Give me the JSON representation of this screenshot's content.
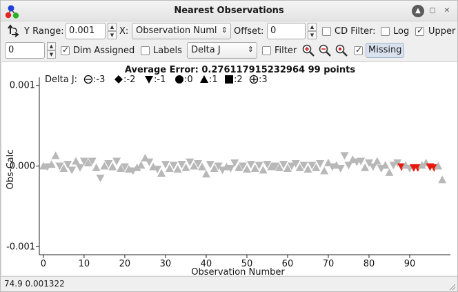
{
  "window": {
    "title": "Nearest Observations",
    "controls": [
      "help-icon",
      "maximize-icon",
      "close-icon"
    ]
  },
  "toolbar": {
    "y_range_label": "Y Range:",
    "y_range_value": "0.001",
    "x_label": "X:",
    "x_select_value": "Observation Numl",
    "offset_label": "Offset:",
    "offset_value": "0",
    "cd_filter_label": "CD Filter:",
    "log_label": "Log",
    "upper_label": "Upper",
    "cd_filter_checked": false,
    "log_checked": false,
    "upper_checked": true,
    "row2_value": "0",
    "dim_assigned_label": "Dim Assigned",
    "dim_assigned_checked": true,
    "labels_label": "Labels",
    "labels_checked": false,
    "color_by_value": "Delta J",
    "filter_label": "Filter",
    "filter_checked": false,
    "missing_label": "Missing",
    "missing_checked": true
  },
  "chart_data": {
    "type": "scatter",
    "title": "Average Error: 0.276117915232964  99 points",
    "xlabel": "Observation Number",
    "ylabel": "Obs-Calc",
    "xlim": [
      -1,
      100
    ],
    "ylim": [
      -0.0011,
      0.0011
    ],
    "xticks": [
      0,
      10,
      20,
      30,
      40,
      50,
      60,
      70,
      80,
      90
    ],
    "yticks": [
      0.001,
      0.0,
      -0.001
    ],
    "ytick_labels": [
      "0.001",
      "0.000",
      "-0.001"
    ],
    "legend_title": "Delta J:",
    "legend": [
      {
        "symbol": "circle-minus",
        "label": ":-3"
      },
      {
        "symbol": "diamond",
        "label": ":-2"
      },
      {
        "symbol": "triangle-down",
        "label": ":-1"
      },
      {
        "symbol": "circle",
        "label": ":0"
      },
      {
        "symbol": "triangle-up",
        "label": ":1"
      },
      {
        "symbol": "square",
        "label": ":2"
      },
      {
        "symbol": "circle-plus",
        "label": ":3"
      }
    ],
    "colors": {
      "default": "#b8b8b8",
      "highlight": "#e8190f"
    },
    "points": [
      {
        "x": 0,
        "y": 0.0,
        "m": "up",
        "c": "default"
      },
      {
        "x": 1,
        "y": -1e-05,
        "m": "down",
        "c": "default"
      },
      {
        "x": 2,
        "y": 2e-05,
        "m": "up",
        "c": "default"
      },
      {
        "x": 3,
        "y": 0.00013,
        "m": "up",
        "c": "default"
      },
      {
        "x": 4,
        "y": 0.0,
        "m": "down",
        "c": "default"
      },
      {
        "x": 5,
        "y": -3e-05,
        "m": "up",
        "c": "default"
      },
      {
        "x": 6,
        "y": 2e-05,
        "m": "down",
        "c": "default"
      },
      {
        "x": 7,
        "y": -5e-05,
        "m": "down",
        "c": "default"
      },
      {
        "x": 8,
        "y": 6e-05,
        "m": "up",
        "c": "default"
      },
      {
        "x": 9,
        "y": -2e-05,
        "m": "down",
        "c": "default"
      },
      {
        "x": 10,
        "y": 6e-05,
        "m": "down",
        "c": "default"
      },
      {
        "x": 11,
        "y": 4e-05,
        "m": "up",
        "c": "default"
      },
      {
        "x": 12,
        "y": 6e-05,
        "m": "down",
        "c": "default"
      },
      {
        "x": 13,
        "y": -2e-05,
        "m": "up",
        "c": "default"
      },
      {
        "x": 14,
        "y": -0.00015,
        "m": "down",
        "c": "default"
      },
      {
        "x": 15,
        "y": 0.0,
        "m": "up",
        "c": "default"
      },
      {
        "x": 16,
        "y": 3e-05,
        "m": "down",
        "c": "default"
      },
      {
        "x": 17,
        "y": -1e-05,
        "m": "up",
        "c": "default"
      },
      {
        "x": 18,
        "y": 6e-05,
        "m": "down",
        "c": "default"
      },
      {
        "x": 19,
        "y": -3e-05,
        "m": "up",
        "c": "default"
      },
      {
        "x": 20,
        "y": -1e-05,
        "m": "down",
        "c": "default"
      },
      {
        "x": 21,
        "y": -4e-05,
        "m": "up",
        "c": "default"
      },
      {
        "x": 22,
        "y": -6e-05,
        "m": "down",
        "c": "default"
      },
      {
        "x": 23,
        "y": -2e-05,
        "m": "up",
        "c": "default"
      },
      {
        "x": 24,
        "y": 1e-05,
        "m": "up",
        "c": "default"
      },
      {
        "x": 25,
        "y": 0.0001,
        "m": "up",
        "c": "default"
      },
      {
        "x": 26,
        "y": 5e-05,
        "m": "down",
        "c": "default"
      },
      {
        "x": 27,
        "y": -1e-05,
        "m": "up",
        "c": "default"
      },
      {
        "x": 28,
        "y": -4e-05,
        "m": "down",
        "c": "default"
      },
      {
        "x": 29,
        "y": -9e-05,
        "m": "up",
        "c": "default"
      },
      {
        "x": 30,
        "y": 2e-05,
        "m": "down",
        "c": "default"
      },
      {
        "x": 31,
        "y": -3e-05,
        "m": "up",
        "c": "default"
      },
      {
        "x": 32,
        "y": 1e-05,
        "m": "down",
        "c": "default"
      },
      {
        "x": 33,
        "y": -4e-05,
        "m": "up",
        "c": "default"
      },
      {
        "x": 34,
        "y": 2e-05,
        "m": "down",
        "c": "default"
      },
      {
        "x": 35,
        "y": -2e-05,
        "m": "up",
        "c": "default"
      },
      {
        "x": 36,
        "y": 5e-05,
        "m": "down",
        "c": "default"
      },
      {
        "x": 37,
        "y": 0.0,
        "m": "up",
        "c": "default"
      },
      {
        "x": 38,
        "y": 3e-05,
        "m": "down",
        "c": "default"
      },
      {
        "x": 39,
        "y": -1e-05,
        "m": "up",
        "c": "default"
      },
      {
        "x": 40,
        "y": -0.0001,
        "m": "up",
        "c": "default"
      },
      {
        "x": 41,
        "y": 2e-05,
        "m": "down",
        "c": "default"
      },
      {
        "x": 42,
        "y": -3e-05,
        "m": "up",
        "c": "default"
      },
      {
        "x": 43,
        "y": 0.0,
        "m": "down",
        "c": "default"
      },
      {
        "x": 44,
        "y": -5e-05,
        "m": "down",
        "c": "default"
      },
      {
        "x": 45,
        "y": -1e-05,
        "m": "up",
        "c": "default"
      },
      {
        "x": 46,
        "y": -3e-05,
        "m": "down",
        "c": "default"
      },
      {
        "x": 47,
        "y": 4e-05,
        "m": "down",
        "c": "default"
      },
      {
        "x": 48,
        "y": -2e-05,
        "m": "up",
        "c": "default"
      },
      {
        "x": 49,
        "y": 0.0,
        "m": "down",
        "c": "default"
      },
      {
        "x": 50,
        "y": -4e-05,
        "m": "up",
        "c": "default"
      },
      {
        "x": 51,
        "y": 2e-05,
        "m": "down",
        "c": "default"
      },
      {
        "x": 52,
        "y": -3e-05,
        "m": "up",
        "c": "default"
      },
      {
        "x": 53,
        "y": 1e-05,
        "m": "down",
        "c": "default"
      },
      {
        "x": 54,
        "y": -5e-05,
        "m": "up",
        "c": "default"
      },
      {
        "x": 55,
        "y": 2e-05,
        "m": "down",
        "c": "default"
      },
      {
        "x": 56,
        "y": -1e-05,
        "m": "up",
        "c": "default"
      },
      {
        "x": 57,
        "y": 0.0,
        "m": "down",
        "c": "default"
      },
      {
        "x": 58,
        "y": -2e-05,
        "m": "up",
        "c": "default"
      },
      {
        "x": 59,
        "y": 2e-05,
        "m": "down",
        "c": "default"
      },
      {
        "x": 60,
        "y": -3e-05,
        "m": "up",
        "c": "default"
      },
      {
        "x": 61,
        "y": 0.0,
        "m": "down",
        "c": "default"
      },
      {
        "x": 62,
        "y": 3e-05,
        "m": "down",
        "c": "default"
      },
      {
        "x": 63,
        "y": -2e-05,
        "m": "up",
        "c": "default"
      },
      {
        "x": 64,
        "y": 1e-05,
        "m": "down",
        "c": "default"
      },
      {
        "x": 65,
        "y": -4e-05,
        "m": "up",
        "c": "default"
      },
      {
        "x": 66,
        "y": 1e-05,
        "m": "down",
        "c": "default"
      },
      {
        "x": 67,
        "y": -2e-05,
        "m": "up",
        "c": "default"
      },
      {
        "x": 68,
        "y": 3e-05,
        "m": "down",
        "c": "default"
      },
      {
        "x": 69,
        "y": -6e-05,
        "m": "up",
        "c": "default"
      },
      {
        "x": 70,
        "y": 4e-05,
        "m": "up",
        "c": "default"
      },
      {
        "x": 71,
        "y": -1e-05,
        "m": "down",
        "c": "default"
      },
      {
        "x": 72,
        "y": 1e-05,
        "m": "up",
        "c": "default"
      },
      {
        "x": 73,
        "y": -3e-05,
        "m": "down",
        "c": "default"
      },
      {
        "x": 74,
        "y": 0.00013,
        "m": "down",
        "c": "default"
      },
      {
        "x": 75,
        "y": 1e-05,
        "m": "down",
        "c": "default"
      },
      {
        "x": 76,
        "y": 8e-05,
        "m": "up",
        "c": "default"
      },
      {
        "x": 77,
        "y": 5e-05,
        "m": "down",
        "c": "default"
      },
      {
        "x": 78,
        "y": 6e-05,
        "m": "down",
        "c": "default"
      },
      {
        "x": 79,
        "y": -2e-05,
        "m": "up",
        "c": "default"
      },
      {
        "x": 80,
        "y": 4e-05,
        "m": "down",
        "c": "default"
      },
      {
        "x": 81,
        "y": -1e-05,
        "m": "down",
        "c": "default"
      },
      {
        "x": 82,
        "y": 6e-05,
        "m": "up",
        "c": "default"
      },
      {
        "x": 83,
        "y": -3e-05,
        "m": "down",
        "c": "default"
      },
      {
        "x": 84,
        "y": 1e-05,
        "m": "up",
        "c": "default"
      },
      {
        "x": 85,
        "y": -8e-05,
        "m": "up",
        "c": "default"
      },
      {
        "x": 86,
        "y": 1e-05,
        "m": "down",
        "c": "default"
      },
      {
        "x": 87,
        "y": 4e-05,
        "m": "down",
        "c": "default"
      },
      {
        "x": 88,
        "y": -1e-05,
        "m": "down",
        "c": "highlight"
      },
      {
        "x": 89,
        "y": 1e-05,
        "m": "up",
        "c": "default"
      },
      {
        "x": 90,
        "y": -3e-05,
        "m": "down",
        "c": "default"
      },
      {
        "x": 91,
        "y": -2e-05,
        "m": "down",
        "c": "highlight"
      },
      {
        "x": 92,
        "y": -2e-05,
        "m": "down",
        "c": "highlight"
      },
      {
        "x": 93,
        "y": 1e-05,
        "m": "up",
        "c": "default"
      },
      {
        "x": 94,
        "y": 4e-05,
        "m": "up",
        "c": "default"
      },
      {
        "x": 95,
        "y": -1e-05,
        "m": "down",
        "c": "highlight"
      },
      {
        "x": 96,
        "y": -2e-05,
        "m": "down",
        "c": "highlight"
      },
      {
        "x": 97,
        "y": 0.0,
        "m": "up",
        "c": "default"
      },
      {
        "x": 98,
        "y": -0.00017,
        "m": "up",
        "c": "default"
      }
    ]
  },
  "status": {
    "text": "74.9  0.001322"
  }
}
